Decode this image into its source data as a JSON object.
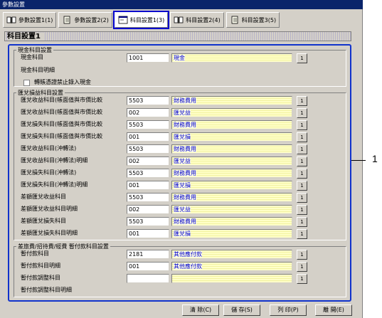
{
  "window": {
    "title": "參數設置"
  },
  "tabs": [
    {
      "label": "參數設置1(1)",
      "icon": "book-icon"
    },
    {
      "label": "參數設置2(2)",
      "icon": "notebook-icon"
    },
    {
      "label": "科目設置1(3)",
      "icon": "window-icon",
      "active": true
    },
    {
      "label": "科目設置2(4)",
      "icon": "book-icon"
    },
    {
      "label": "科目設置3(5)",
      "icon": "notebook-icon"
    }
  ],
  "section_title": "科目設置1",
  "cash_group": {
    "title": "現金科目設置",
    "rows": [
      {
        "label": "現金科目",
        "code": "1001",
        "name": "現金",
        "btn": "1"
      },
      {
        "label": "現金科目明細"
      }
    ],
    "checkbox_label": "轉賬憑證禁止錄入現金"
  },
  "fx_group": {
    "title": "匯兌損益科目設置",
    "rows": [
      {
        "label": "匯兌收益科目(帳面值與市價比較",
        "code": "5503",
        "name": "財務費用",
        "btn": "1"
      },
      {
        "label": "匯兌收益科目(帳面值與市價比較",
        "code": "002",
        "name": "匯兌益",
        "btn": "1"
      },
      {
        "label": "匯兌損失科目(帳面值與市價比較",
        "code": "5503",
        "name": "財務費用",
        "btn": "1"
      },
      {
        "label": "匯兌損失科目(帳面值與市價比較",
        "code": "001",
        "name": "匯兌損",
        "btn": "1"
      },
      {
        "label": "匯兌收益科目(沖轉法)",
        "code": "5503",
        "name": "財務費用",
        "btn": "1"
      },
      {
        "label": "匯兌收益科目(沖轉法)明細",
        "code": "002",
        "name": "匯兌益",
        "btn": "1"
      },
      {
        "label": "匯兌損失科目(沖轉法)",
        "code": "5503",
        "name": "財務費用",
        "btn": "1"
      },
      {
        "label": "匯兌損失科目(沖轉法)明細",
        "code": "001",
        "name": "匯兌損",
        "btn": "1"
      },
      {
        "label": "差額匯兌收益科目",
        "code": "5503",
        "name": "財務費用",
        "btn": "1"
      },
      {
        "label": "差額匯兌收益科目明細",
        "code": "002",
        "name": "匯兌益",
        "btn": "1"
      },
      {
        "label": "差額匯兌損失科目",
        "code": "5503",
        "name": "財務費用",
        "btn": "1"
      },
      {
        "label": "差額匯兌損失科目明細",
        "code": "001",
        "name": "匯兌損",
        "btn": "1"
      }
    ]
  },
  "travel_group": {
    "title": "差旅費/招待費/經費 暫付款科目設置",
    "rows": [
      {
        "label": "暫付款科目",
        "code": "2181",
        "name": "其他應付款",
        "btn": "1"
      },
      {
        "label": "暫付款科目明細",
        "code": "001",
        "name": "其他應付款",
        "btn": "1"
      },
      {
        "label": "暫付款調整科目",
        "code": "",
        "name": "",
        "btn": "1"
      },
      {
        "label": "暫付款調整科目明細"
      }
    ]
  },
  "buttons": {
    "clear": "清 除(C)",
    "save": "儲 存(S)",
    "print": "列 印(P)",
    "exit": "離 開(E)"
  },
  "callout": "1"
}
